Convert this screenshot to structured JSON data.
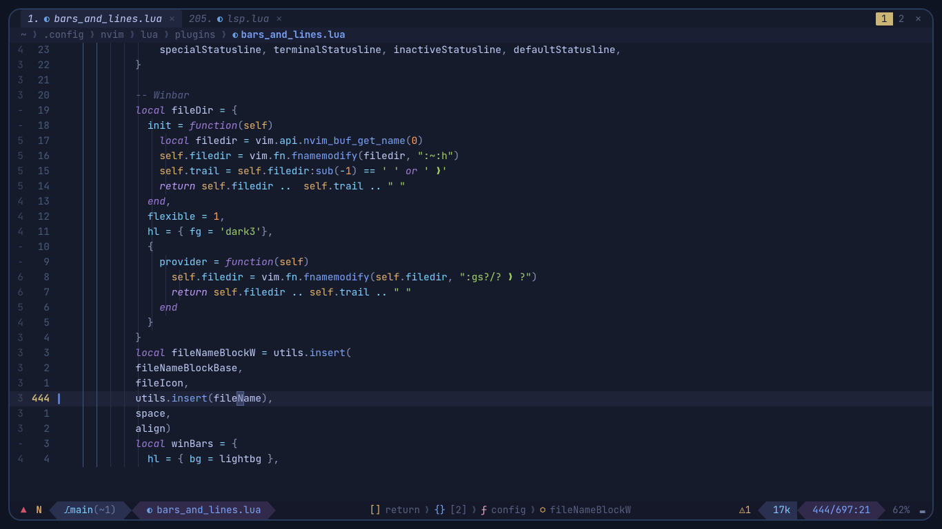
{
  "tabs": [
    {
      "num": "1.",
      "file": "bars_and_lines.lua",
      "active": true
    },
    {
      "num": "205.",
      "file": "lsp.lua",
      "active": false
    }
  ],
  "tabcount": {
    "active": "1",
    "inactive": "2",
    "close": "✕"
  },
  "winbar": {
    "crumbs": [
      "~",
      ".config",
      "nvim",
      "lua",
      "plugins"
    ],
    "file": "bars_and_lines.lua",
    "sep": "❯"
  },
  "lines": [
    {
      "fold": "4",
      "num": "23",
      "indent": 5,
      "ctx": 2,
      "git": false,
      "tokens": [
        [
          5,
          "  "
        ],
        [
          "var",
          "specialStatusline"
        ],
        [
          "punc",
          ", "
        ],
        [
          "var",
          "terminalStatusline"
        ],
        [
          "punc",
          ", "
        ],
        [
          "var",
          "inactiveStatusline"
        ],
        [
          "punc",
          ", "
        ],
        [
          "var",
          "defaultStatusline"
        ],
        [
          "punc",
          ","
        ]
      ]
    },
    {
      "fold": "3",
      "num": "22",
      "indent": 5,
      "ctx": 2,
      "git": false,
      "tokens": [
        [
          4,
          ""
        ],
        [
          "punc",
          "}"
        ]
      ]
    },
    {
      "fold": "3",
      "num": "21",
      "indent": 5,
      "ctx": 2,
      "git": false,
      "tokens": [
        [
          4,
          ""
        ]
      ]
    },
    {
      "fold": "3",
      "num": "20",
      "indent": 5,
      "ctx": 2,
      "git": false,
      "tokens": [
        [
          4,
          ""
        ],
        [
          "comment",
          "-- Winbar"
        ]
      ]
    },
    {
      "fold": "-",
      "num": "19",
      "indent": 5,
      "ctx": 2,
      "git": false,
      "tokens": [
        [
          4,
          ""
        ],
        [
          "kw",
          "local"
        ],
        [
          "",
          " "
        ],
        [
          "var",
          "fileDir"
        ],
        [
          "",
          " "
        ],
        [
          "op",
          "="
        ],
        [
          "",
          " "
        ],
        [
          "punc",
          "{"
        ]
      ]
    },
    {
      "fold": "-",
      "num": "18",
      "indent": 6,
      "ctx": 2,
      "git": false,
      "tokens": [
        [
          5,
          ""
        ],
        [
          "field",
          "init"
        ],
        [
          "",
          " "
        ],
        [
          "op",
          "="
        ],
        [
          "",
          " "
        ],
        [
          "kw",
          "function"
        ],
        [
          "punc",
          "("
        ],
        [
          "self",
          "self"
        ],
        [
          "punc",
          ")"
        ]
      ]
    },
    {
      "fold": "5",
      "num": "17",
      "indent": 7,
      "ctx": 2,
      "git": false,
      "tokens": [
        [
          6,
          ""
        ],
        [
          "kw",
          "local"
        ],
        [
          "",
          " "
        ],
        [
          "var",
          "filedir"
        ],
        [
          "",
          " "
        ],
        [
          "op",
          "="
        ],
        [
          "",
          " "
        ],
        [
          "var",
          "vim"
        ],
        [
          "punc",
          "."
        ],
        [
          "field",
          "api"
        ],
        [
          "punc",
          "."
        ],
        [
          "fn",
          "nvim_buf_get_name"
        ],
        [
          "punc",
          "("
        ],
        [
          "num",
          "0"
        ],
        [
          "punc",
          ")"
        ]
      ]
    },
    {
      "fold": "5",
      "num": "16",
      "indent": 7,
      "ctx": 2,
      "git": false,
      "tokens": [
        [
          6,
          ""
        ],
        [
          "self",
          "self"
        ],
        [
          "punc",
          "."
        ],
        [
          "field",
          "filedir"
        ],
        [
          "",
          " "
        ],
        [
          "op",
          "="
        ],
        [
          "",
          " "
        ],
        [
          "var",
          "vim"
        ],
        [
          "punc",
          "."
        ],
        [
          "field",
          "fn"
        ],
        [
          "punc",
          "."
        ],
        [
          "fn",
          "fnamemodify"
        ],
        [
          "punc",
          "("
        ],
        [
          "var",
          "filedir"
        ],
        [
          "punc",
          ", "
        ],
        [
          "str",
          "\":~:h\""
        ],
        [
          "punc",
          ")"
        ]
      ]
    },
    {
      "fold": "5",
      "num": "15",
      "indent": 7,
      "ctx": 2,
      "git": false,
      "tokens": [
        [
          6,
          ""
        ],
        [
          "self",
          "self"
        ],
        [
          "punc",
          "."
        ],
        [
          "field",
          "trail"
        ],
        [
          "",
          " "
        ],
        [
          "op",
          "="
        ],
        [
          "",
          " "
        ],
        [
          "self",
          "self"
        ],
        [
          "punc",
          "."
        ],
        [
          "field",
          "filedir"
        ],
        [
          "punc",
          ":"
        ],
        [
          "fn",
          "sub"
        ],
        [
          "punc",
          "("
        ],
        [
          "op",
          "-"
        ],
        [
          "num",
          "1"
        ],
        [
          "punc",
          ")"
        ],
        [
          "",
          " "
        ],
        [
          "op",
          "=="
        ],
        [
          "",
          " "
        ],
        [
          "str",
          "' '"
        ],
        [
          "",
          " "
        ],
        [
          "kw",
          "or"
        ],
        [
          "",
          " "
        ],
        [
          "str",
          "' ❯'"
        ]
      ]
    },
    {
      "fold": "5",
      "num": "14",
      "indent": 7,
      "ctx": 2,
      "git": false,
      "tokens": [
        [
          6,
          ""
        ],
        [
          "kw2",
          "return"
        ],
        [
          "",
          " "
        ],
        [
          "self",
          "self"
        ],
        [
          "punc",
          "."
        ],
        [
          "field",
          "filedir"
        ],
        [
          "",
          " "
        ],
        [
          "op",
          ".."
        ],
        [
          "",
          "  "
        ],
        [
          "self",
          "self"
        ],
        [
          "punc",
          "."
        ],
        [
          "field",
          "trail"
        ],
        [
          "",
          " "
        ],
        [
          "op",
          ".."
        ],
        [
          "",
          " "
        ],
        [
          "str",
          "\" \""
        ]
      ]
    },
    {
      "fold": "4",
      "num": "13",
      "indent": 6,
      "ctx": 2,
      "git": false,
      "tokens": [
        [
          5,
          ""
        ],
        [
          "kw",
          "end"
        ],
        [
          "punc",
          ","
        ]
      ]
    },
    {
      "fold": "4",
      "num": "12",
      "indent": 6,
      "ctx": 2,
      "git": false,
      "tokens": [
        [
          5,
          ""
        ],
        [
          "field",
          "flexible"
        ],
        [
          "",
          " "
        ],
        [
          "op",
          "="
        ],
        [
          "",
          " "
        ],
        [
          "num",
          "1"
        ],
        [
          "punc",
          ","
        ]
      ]
    },
    {
      "fold": "4",
      "num": "11",
      "indent": 6,
      "ctx": 2,
      "git": false,
      "tokens": [
        [
          5,
          ""
        ],
        [
          "field",
          "hl"
        ],
        [
          "",
          " "
        ],
        [
          "op",
          "="
        ],
        [
          "",
          " "
        ],
        [
          "punc",
          "{ "
        ],
        [
          "field",
          "fg"
        ],
        [
          "",
          " "
        ],
        [
          "op",
          "="
        ],
        [
          "",
          " "
        ],
        [
          "str",
          "'dark3'"
        ],
        [
          "punc",
          "},"
        ]
      ]
    },
    {
      "fold": "-",
      "num": "10",
      "indent": 6,
      "ctx": 2,
      "git": false,
      "tokens": [
        [
          5,
          ""
        ],
        [
          "punc",
          "{"
        ]
      ]
    },
    {
      "fold": "-",
      "num": "9",
      "indent": 7,
      "ctx": 2,
      "git": false,
      "tokens": [
        [
          6,
          ""
        ],
        [
          "field",
          "provider"
        ],
        [
          "",
          " "
        ],
        [
          "op",
          "="
        ],
        [
          "",
          " "
        ],
        [
          "kw",
          "function"
        ],
        [
          "punc",
          "("
        ],
        [
          "self",
          "self"
        ],
        [
          "punc",
          ")"
        ]
      ]
    },
    {
      "fold": "6",
      "num": "8",
      "indent": 8,
      "ctx": 2,
      "git": false,
      "tokens": [
        [
          7,
          ""
        ],
        [
          "self",
          "self"
        ],
        [
          "punc",
          "."
        ],
        [
          "field",
          "filedir"
        ],
        [
          "",
          " "
        ],
        [
          "op",
          "="
        ],
        [
          "",
          " "
        ],
        [
          "var",
          "vim"
        ],
        [
          "punc",
          "."
        ],
        [
          "field",
          "fn"
        ],
        [
          "punc",
          "."
        ],
        [
          "fn",
          "fnamemodify"
        ],
        [
          "punc",
          "("
        ],
        [
          "self",
          "self"
        ],
        [
          "punc",
          "."
        ],
        [
          "field",
          "filedir"
        ],
        [
          "punc",
          ", "
        ],
        [
          "str",
          "\":gs?/? ❯ ?\""
        ],
        [
          "punc",
          ")"
        ]
      ]
    },
    {
      "fold": "6",
      "num": "7",
      "indent": 8,
      "ctx": 2,
      "git": false,
      "tokens": [
        [
          7,
          ""
        ],
        [
          "kw2",
          "return"
        ],
        [
          "",
          " "
        ],
        [
          "self",
          "self"
        ],
        [
          "punc",
          "."
        ],
        [
          "field",
          "filedir"
        ],
        [
          "",
          " "
        ],
        [
          "op",
          ".."
        ],
        [
          "",
          " "
        ],
        [
          "self",
          "self"
        ],
        [
          "punc",
          "."
        ],
        [
          "field",
          "trail"
        ],
        [
          "",
          " "
        ],
        [
          "op",
          ".."
        ],
        [
          "",
          " "
        ],
        [
          "str",
          "\" \""
        ]
      ]
    },
    {
      "fold": "5",
      "num": "6",
      "indent": 7,
      "ctx": 2,
      "git": false,
      "tokens": [
        [
          6,
          ""
        ],
        [
          "kw",
          "end"
        ]
      ]
    },
    {
      "fold": "4",
      "num": "5",
      "indent": 6,
      "ctx": 2,
      "git": false,
      "tokens": [
        [
          5,
          ""
        ],
        [
          "punc",
          "}"
        ]
      ]
    },
    {
      "fold": "3",
      "num": "4",
      "indent": 5,
      "ctx": 2,
      "git": false,
      "tokens": [
        [
          4,
          ""
        ],
        [
          "punc",
          "}"
        ]
      ]
    },
    {
      "fold": "3",
      "num": "3",
      "indent": 5,
      "ctx": 2,
      "git": false,
      "tokens": [
        [
          4,
          ""
        ],
        [
          "kw",
          "local"
        ],
        [
          "",
          " "
        ],
        [
          "var",
          "fileNameBlockW"
        ],
        [
          "",
          " "
        ],
        [
          "op",
          "="
        ],
        [
          "",
          " "
        ],
        [
          "var",
          "utils"
        ],
        [
          "punc",
          "."
        ],
        [
          "fn",
          "insert"
        ],
        [
          "punc",
          "("
        ]
      ]
    },
    {
      "fold": "3",
      "num": "2",
      "indent": 5,
      "ctx": 2,
      "git": false,
      "tokens": [
        [
          4,
          ""
        ],
        [
          "var",
          "fileNameBlockBase"
        ],
        [
          "punc",
          ","
        ]
      ]
    },
    {
      "fold": "3",
      "num": "1",
      "indent": 5,
      "ctx": 2,
      "git": false,
      "tokens": [
        [
          4,
          ""
        ],
        [
          "var",
          "fileIcon"
        ],
        [
          "punc",
          ","
        ]
      ]
    },
    {
      "fold": "3",
      "num": "444",
      "indent": 5,
      "ctx": 2,
      "git": true,
      "current": true,
      "tokens": [
        [
          4,
          ""
        ],
        [
          "var",
          "utils"
        ],
        [
          "punc",
          "."
        ],
        [
          "fn",
          "insert"
        ],
        [
          "punc",
          "("
        ],
        [
          "var",
          "file"
        ],
        [
          "cursor",
          "N"
        ],
        [
          "var",
          "ame"
        ],
        [
          "punc",
          ")"
        ],
        [
          "punc",
          ","
        ]
      ]
    },
    {
      "fold": "3",
      "num": "1",
      "indent": 5,
      "ctx": 2,
      "git": false,
      "tokens": [
        [
          4,
          ""
        ],
        [
          "var",
          "space"
        ],
        [
          "punc",
          ","
        ]
      ]
    },
    {
      "fold": "3",
      "num": "2",
      "indent": 5,
      "ctx": 2,
      "git": false,
      "tokens": [
        [
          4,
          ""
        ],
        [
          "var",
          "align"
        ],
        [
          "punc",
          ")"
        ]
      ]
    },
    {
      "fold": "-",
      "num": "3",
      "indent": 5,
      "ctx": 2,
      "git": false,
      "tokens": [
        [
          4,
          ""
        ],
        [
          "kw",
          "local"
        ],
        [
          "",
          " "
        ],
        [
          "var",
          "winBars"
        ],
        [
          "",
          " "
        ],
        [
          "op",
          "="
        ],
        [
          "",
          " "
        ],
        [
          "punc",
          "{"
        ]
      ]
    },
    {
      "fold": "4",
      "num": "4",
      "indent": 6,
      "ctx": 2,
      "git": false,
      "tokens": [
        [
          5,
          ""
        ],
        [
          "field",
          "hl"
        ],
        [
          "",
          " "
        ],
        [
          "op",
          "="
        ],
        [
          "",
          " "
        ],
        [
          "punc",
          "{ "
        ],
        [
          "field",
          "bg"
        ],
        [
          "",
          " "
        ],
        [
          "op",
          "="
        ],
        [
          "",
          " "
        ],
        [
          "var",
          "lightbg"
        ],
        [
          "",
          " "
        ],
        [
          "punc",
          "},"
        ]
      ]
    }
  ],
  "status": {
    "logo": "▲",
    "mode": "N",
    "branch": {
      "icon": "⎇",
      "name": "main",
      "suffix": "(~1)"
    },
    "file": "bars_and_lines.lua",
    "context": [
      {
        "sym": "[]",
        "cls": "csym",
        "txt": "return"
      },
      {
        "sym": "{}",
        "cls": "csym blue",
        "txt": "[2]"
      },
      {
        "sym": "ƒ",
        "cls": "csym pink",
        "txt": "config"
      },
      {
        "sym": "⬡",
        "cls": "csym cube",
        "txt": "fileNameBlockW"
      }
    ],
    "csep": "❯",
    "diag": {
      "icon": "⚠",
      "count": "1"
    },
    "words": "17k",
    "pos": "444/697:21",
    "pct": "62%",
    "scroll": "▬"
  }
}
